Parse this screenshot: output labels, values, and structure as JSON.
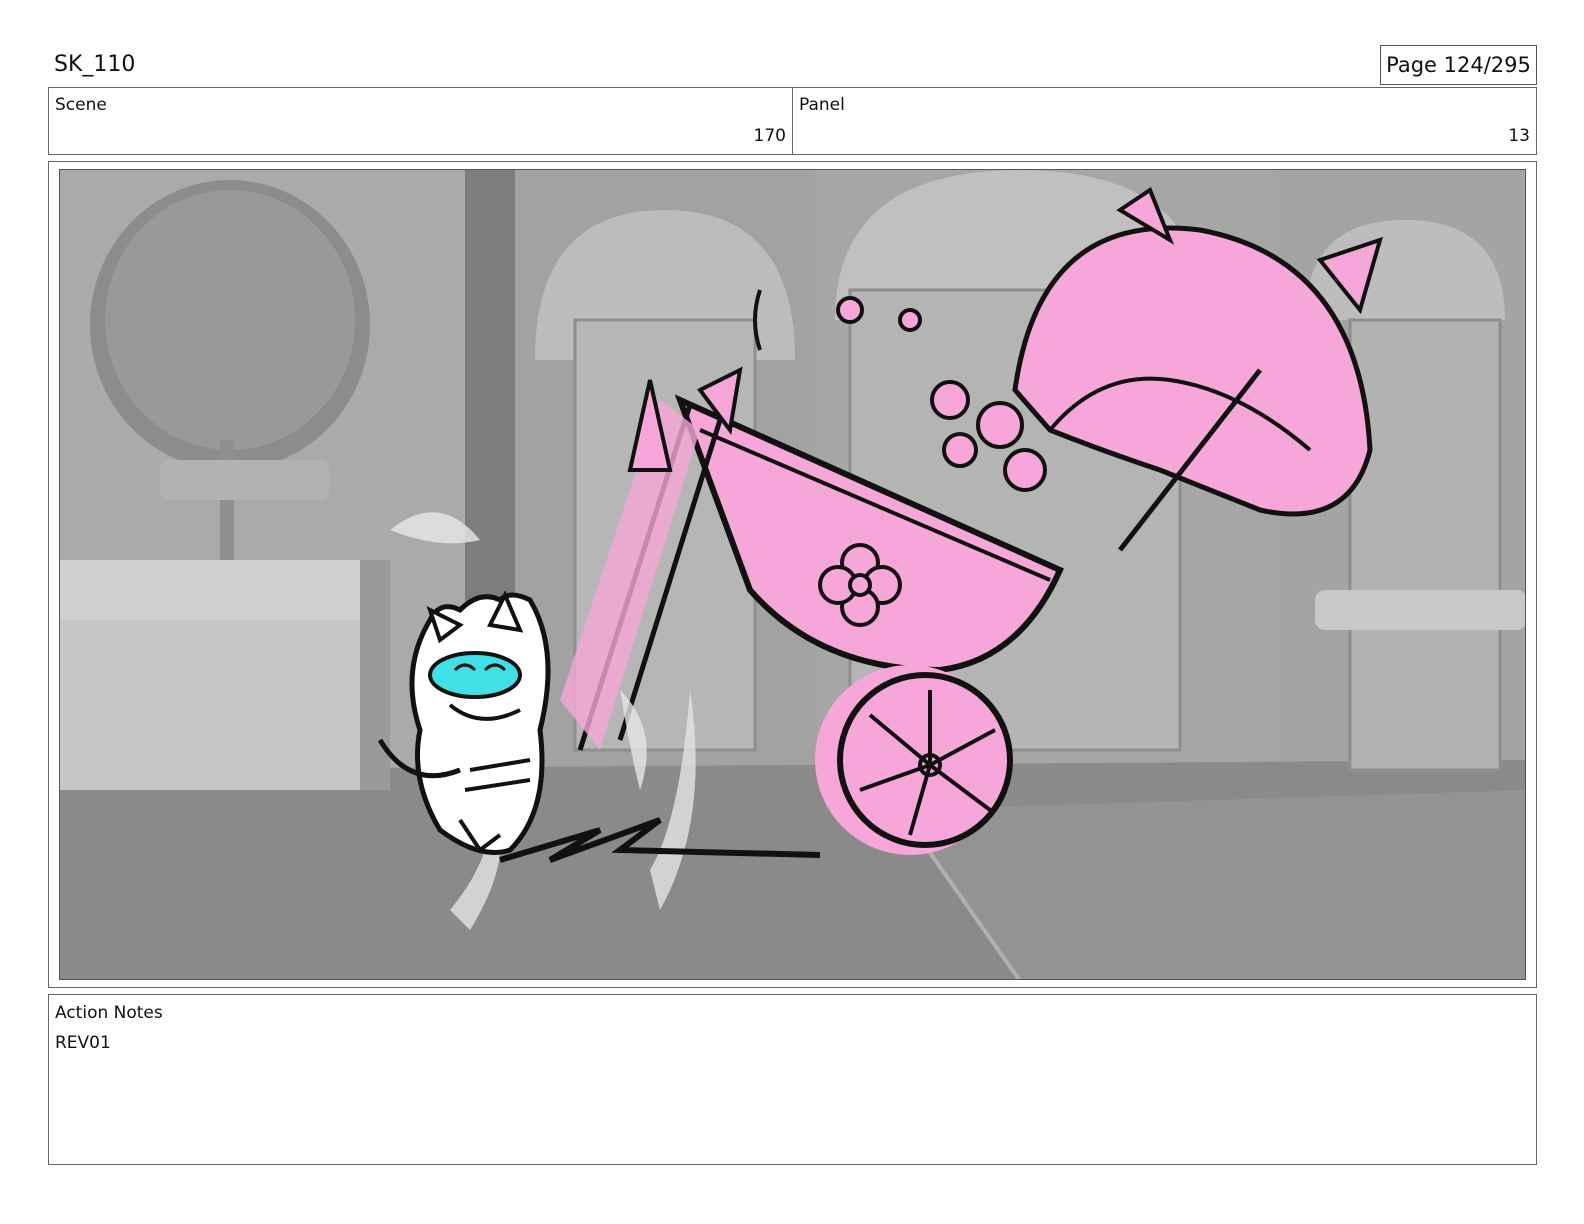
{
  "header": {
    "doc_id": "SK_110",
    "page": "Page 124/295"
  },
  "info": {
    "scene_label": "Scene",
    "scene_value": "170",
    "panel_label": "Panel",
    "panel_value": "13"
  },
  "notes": {
    "label": "Action Notes",
    "text": "REV01"
  },
  "colors": {
    "pink": "#f6a6d8",
    "cyan": "#3fe0e6",
    "background_gray": "#a9a9a9"
  }
}
